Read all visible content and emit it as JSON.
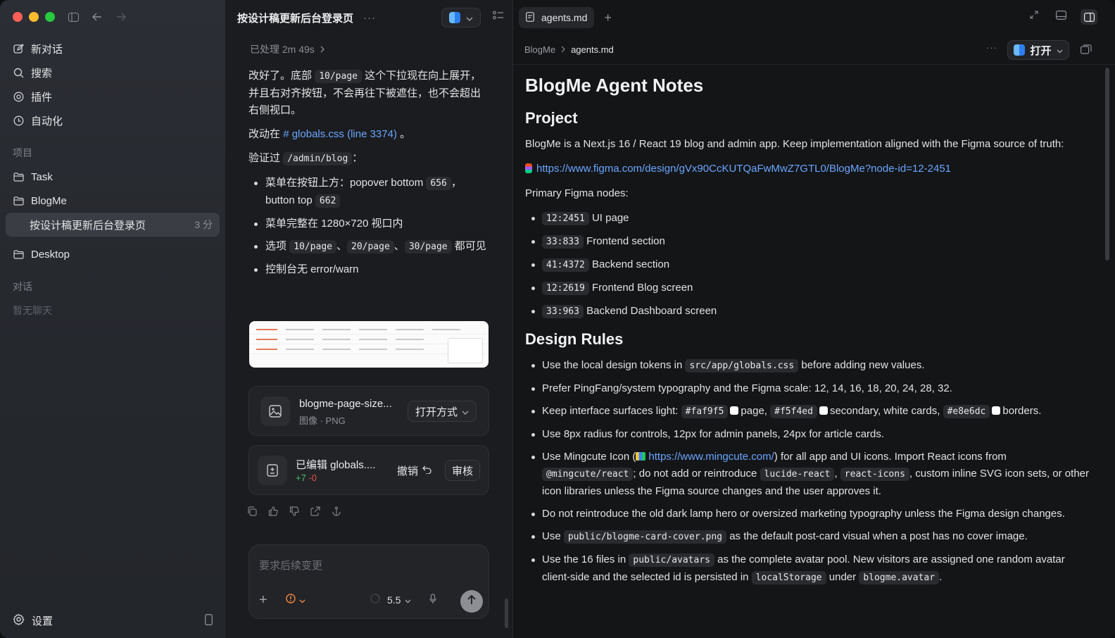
{
  "sidebar": {
    "nav": [
      {
        "label": "新对话",
        "icon": "compose-icon"
      },
      {
        "label": "搜索",
        "icon": "search-icon"
      },
      {
        "label": "插件",
        "icon": "at-icon"
      },
      {
        "label": "自动化",
        "icon": "clock-icon"
      }
    ],
    "projects_title": "项目",
    "projects": [
      {
        "label": "Task"
      },
      {
        "label": "BlogMe"
      }
    ],
    "active_thread": {
      "label": "按设计稿更新后台登录页",
      "meta": "3 分"
    },
    "desktop": "Desktop",
    "conversations_title": "对话",
    "conversations_empty": "暂无聊天",
    "settings_label": "设置"
  },
  "chat": {
    "title": "按设计稿更新后台登录页",
    "processed": "已处理 2m 49s",
    "p1_a": "改好了。底部",
    "p1_code": "10/page",
    "p1_b": "这个下拉现在向上展开，并且右对齐按钮，不会再往下被遮住，也不会超出右侧视口。",
    "p2_a": "改动在",
    "p2_link": "globals.css (line 3374)",
    "p2_b": "。",
    "p3_a": "验证过",
    "p3_code": "/admin/blog",
    "p3_b": "：",
    "b1_a": "菜单在按钮上方：popover bottom",
    "b1_c1": "656",
    "b1_b": "，button top",
    "b1_c2": "662",
    "b2": "菜单完整在 1280×720 视口内",
    "b3_a": "选项",
    "b3_c1": "10/page",
    "b3_c2": "20/page",
    "b3_c3": "30/page",
    "b3_b": "都可见",
    "sep": "、",
    "b4": "控制台无 error/warn",
    "file_card": {
      "title": "blogme-page-size...",
      "sub": "图像 · PNG",
      "button": "打开方式"
    },
    "edit_card": {
      "title": "已编辑 globals....",
      "plus": "+7",
      "minus": "-0",
      "undo": "撤销",
      "review": "审核"
    },
    "composer": {
      "placeholder": "要求后续变更",
      "model": "5.5"
    }
  },
  "doc": {
    "tab": "agents.md",
    "crumb_root": "BlogMe",
    "crumb_file": "agents.md",
    "open_label": "打开",
    "h1": "BlogMe Agent Notes",
    "h_project": "Project",
    "project_text": "BlogMe is a Next.js 16 / React 19 blog and admin app. Keep implementation aligned with the Figma source of truth:",
    "figma_url": "https://www.figma.com/design/gVx90CcKUTQaFwMwZ7GTL0/BlogMe?node-id=12-2451",
    "nodes_label": "Primary Figma nodes:",
    "nodes": [
      {
        "id": "12:2451",
        "label": "UI page"
      },
      {
        "id": "33:833",
        "label": "Frontend section"
      },
      {
        "id": "41:4372",
        "label": "Backend section"
      },
      {
        "id": "12:2619",
        "label": "Frontend Blog screen"
      },
      {
        "id": "33:963",
        "label": "Backend Dashboard screen"
      }
    ],
    "h_rules": "Design Rules",
    "r1_a": "Use the local design tokens in",
    "r1_code": "src/app/globals.css",
    "r1_b": "before adding new values.",
    "r2": "Prefer PingFang/system typography and the Figma scale: 12, 14, 16, 18, 20, 24, 28, 32.",
    "r3_a": "Keep interface surfaces light:",
    "r3_c1": "#faf9f5",
    "r3_b": "page,",
    "r3_c2": "#f5f4ed",
    "r3_c": "secondary, white cards,",
    "r3_c3": "#e8e6dc",
    "r3_d": "borders.",
    "r4": "Use 8px radius for controls, 12px for admin panels, 24px for article cards.",
    "r5_a": "Use Mingcute Icon (",
    "r5_link": "https://www.mingcute.com/",
    "r5_b": ") for all app and UI icons. Import React icons from",
    "r5_c1": "@mingcute/react",
    "r5_c": "; do not add or reintroduce",
    "r5_c2": "lucide-react",
    "r5_comma": ",",
    "r5_c3": "react-icons",
    "r5_d": ", custom inline SVG icon sets, or other icon libraries unless the Figma source changes and the user approves it.",
    "r6": "Do not reintroduce the old dark lamp hero or oversized marketing typography unless the Figma design changes.",
    "r7_a": "Use",
    "r7_code": "public/blogme-card-cover.png",
    "r7_b": "as the default post-card visual when a post has no cover image.",
    "r8_a": "Use the 16 files in",
    "r8_c1": "public/avatars",
    "r8_b": "as the complete avatar pool. New visitors are assigned one random avatar client-side and the selected id is persisted in",
    "r8_c2": "localStorage",
    "r8_c": "under",
    "r8_c3": "blogme.avatar",
    "r8_d": "."
  }
}
